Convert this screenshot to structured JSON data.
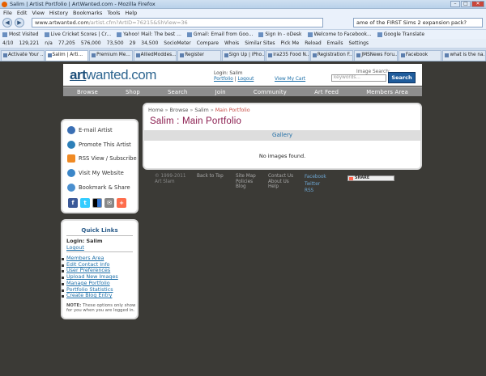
{
  "browser": {
    "window_title": "Salim | Artist Portfolio | ArtWanted.com - Mozilla Firefox",
    "menu": [
      "File",
      "Edit",
      "View",
      "History",
      "Bookmarks",
      "Tools",
      "Help"
    ],
    "url": "www.artwanted.com",
    "url_rest": "/artist.cfm?ArtID=76215&ShView=36",
    "search_value": "ame of the FIRST Sims 2 expansion pack?",
    "bookmarks": [
      "Most Visited",
      "Live Cricket Scores | Cr...",
      "Yahoo! Mail: The best ...",
      "Gmail: Email from Goo...",
      "Sign In - oDesk",
      "Welcome to Facebook...",
      "Google Translate"
    ],
    "toolbar2": [
      "4/10",
      "129,221",
      "n/a",
      "77,205",
      "576,000",
      "73,500",
      "29",
      "34,500",
      "SocioMeter",
      "Compare",
      "Whois",
      "Similar Sites",
      "Pick Me",
      "Reload",
      "Emails",
      "Settings"
    ],
    "tabs": [
      "Activate Your ...",
      "Salim | Arti...",
      "Premium Me...",
      "AlliedModdes...",
      "Register",
      "Sign Up | iPho...",
      "ira235 Food N...",
      "Registration F...",
      "JMSNews Foru...",
      "Facebook",
      "what is the na..."
    ]
  },
  "site": {
    "logo_art": "art",
    "logo_rest": "wanted.com",
    "login_label": "Login: Salim",
    "portfolio_link": "Portfolio",
    "separator": "|",
    "logout_link": "Logout",
    "my_cart": "View My Cart",
    "image_search_label": "Image Search:",
    "keywords_placeholder": "keywords...",
    "search_button": "Search",
    "nav": [
      "Browse",
      "Shop",
      "Search",
      "Join",
      "Community",
      "Art Feed",
      "Members Area"
    ]
  },
  "sidebar": {
    "items": [
      "E-mail Artist",
      "Promote This Artist",
      "RSS View / Subscribe",
      "Visit My Website",
      "Bookmark & Share"
    ],
    "share_icons": [
      "facebook-icon",
      "twitter-icon",
      "delicious-icon",
      "email-icon",
      "addthis-icon"
    ]
  },
  "quicklinks": {
    "title": "Quick Links",
    "login": "Login: Salim",
    "logout": "Logout",
    "links": [
      "Members Area",
      "Edit Contact Info",
      "User Preferences",
      "Upload New Images",
      "Manage Portfolio",
      "Portfolio Statistics",
      "Create Blog Entry"
    ],
    "note_label": "NOTE:",
    "note_text": "These options only show for you when you are logged in."
  },
  "content": {
    "breadcrumb": [
      "Home",
      "Browse",
      "Salim",
      "Main Portfolio"
    ],
    "breadcrumb_sep": "»",
    "title": "Salim : Main Portfolio",
    "gallery_label": "Gallery",
    "empty_message": "No images found."
  },
  "footer": {
    "copyright": [
      "© 1999-2011",
      "Art Slam"
    ],
    "back_to_top": "Back to Top",
    "col1": [
      "Site Map",
      "Policies",
      "Blog"
    ],
    "col2": [
      "Contact Us",
      "About Us",
      "Help"
    ],
    "social": [
      "Facebook",
      "Twitter",
      "RSS"
    ],
    "share_badge": "SHARE"
  }
}
